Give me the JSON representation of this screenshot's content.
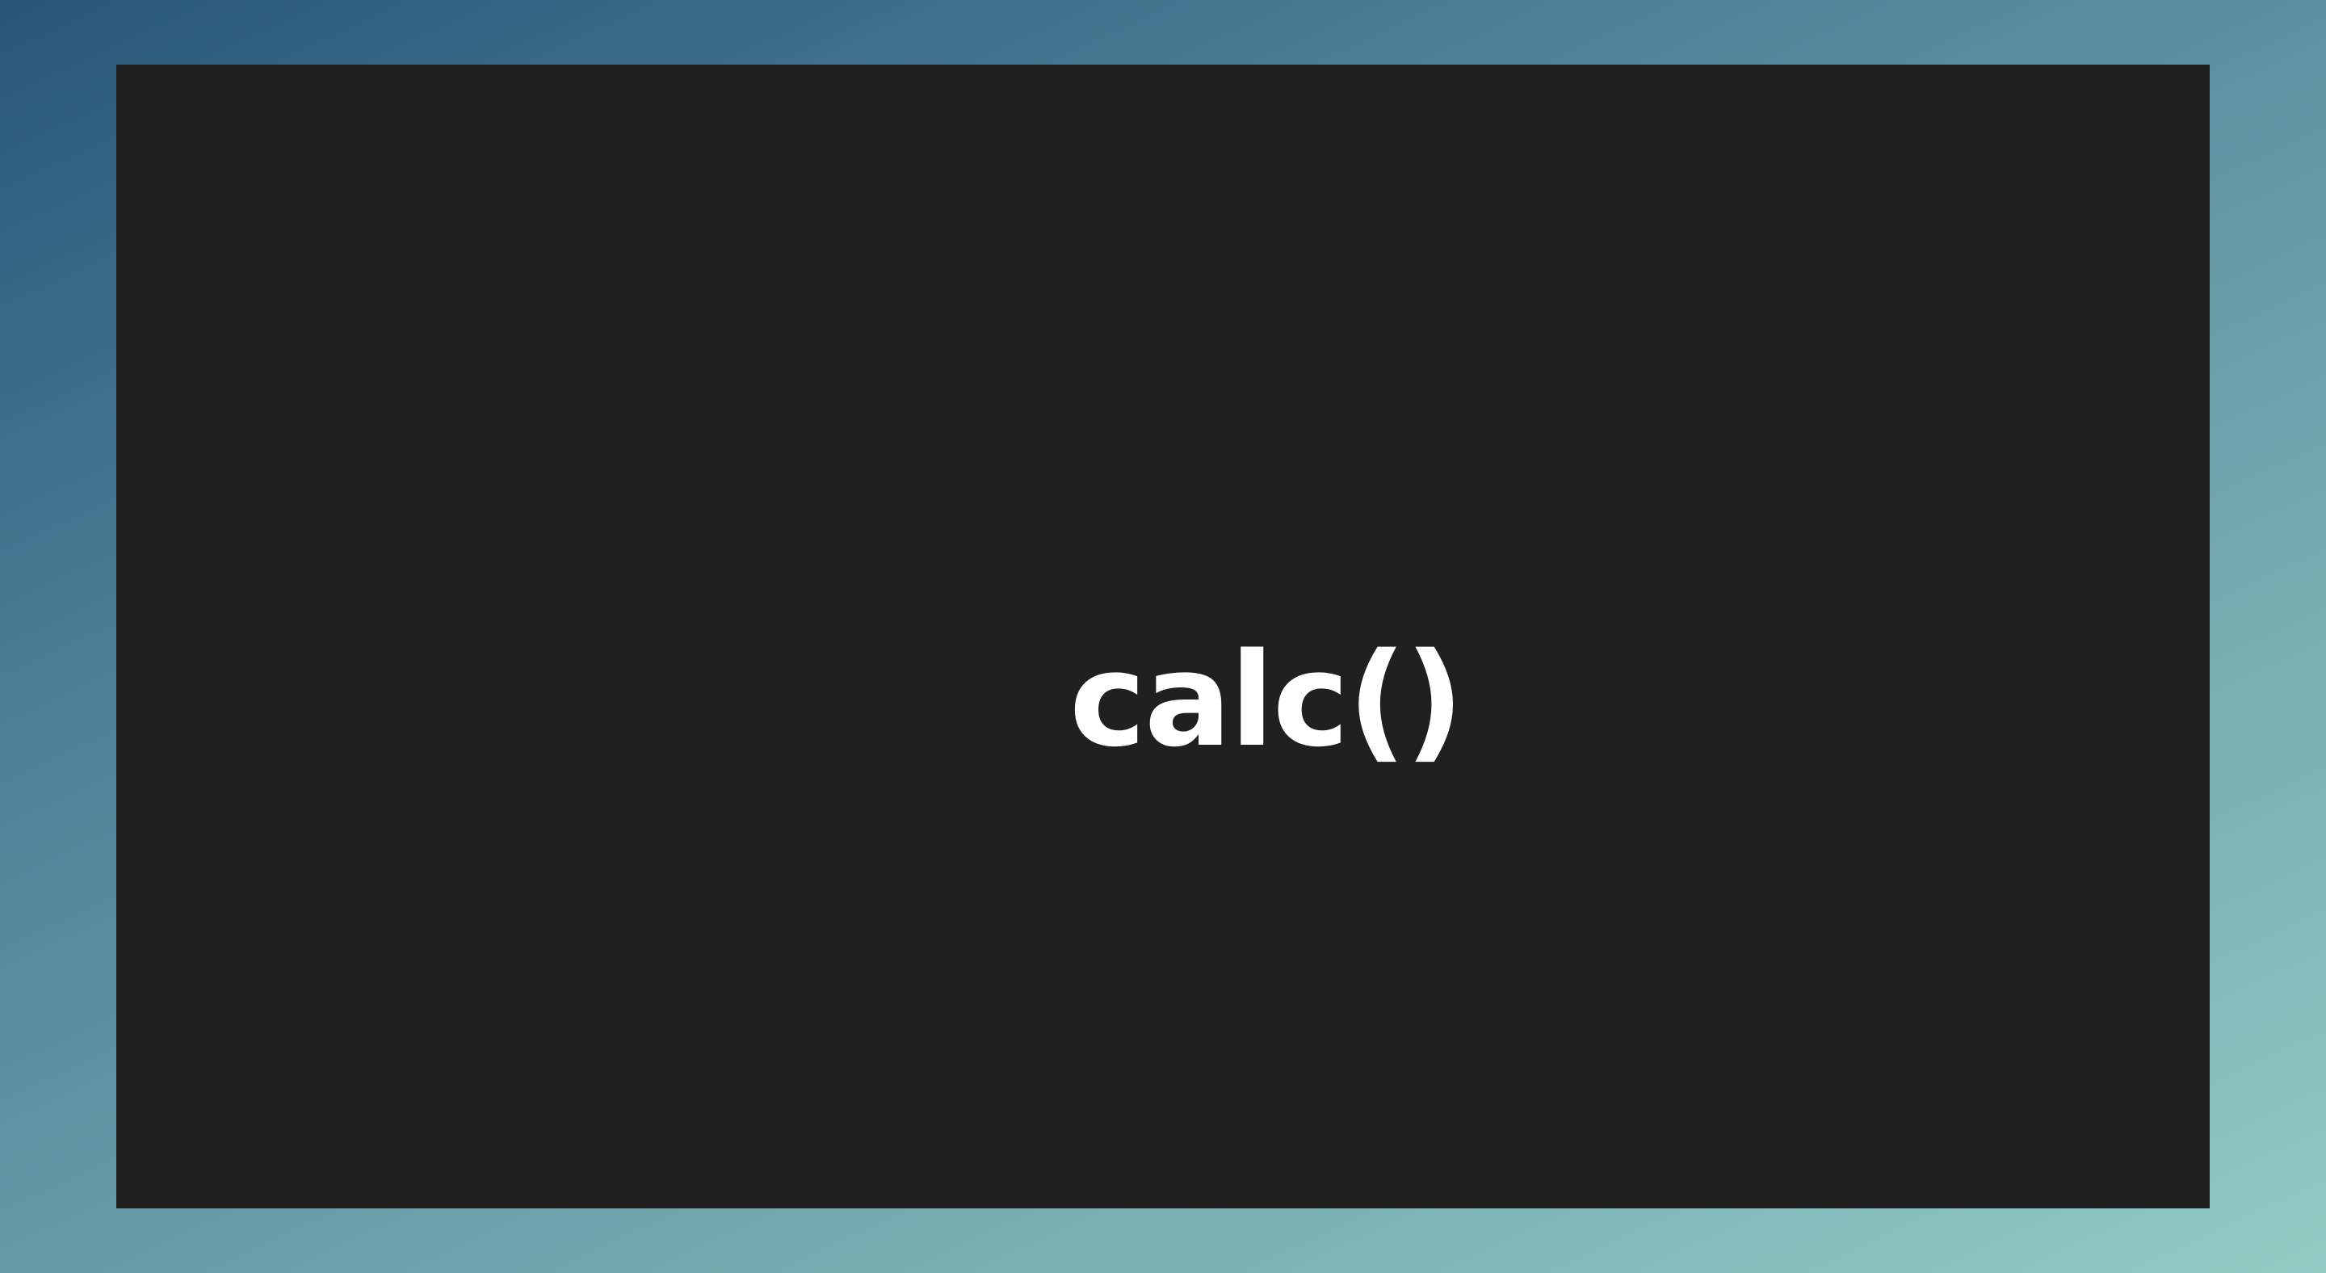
{
  "slide": {
    "title": "calc()"
  },
  "colors": {
    "background_gradient_start": "#285679",
    "background_gradient_end": "#90cbc4",
    "slide_background": "#202020",
    "title_text": "#ffffff"
  }
}
